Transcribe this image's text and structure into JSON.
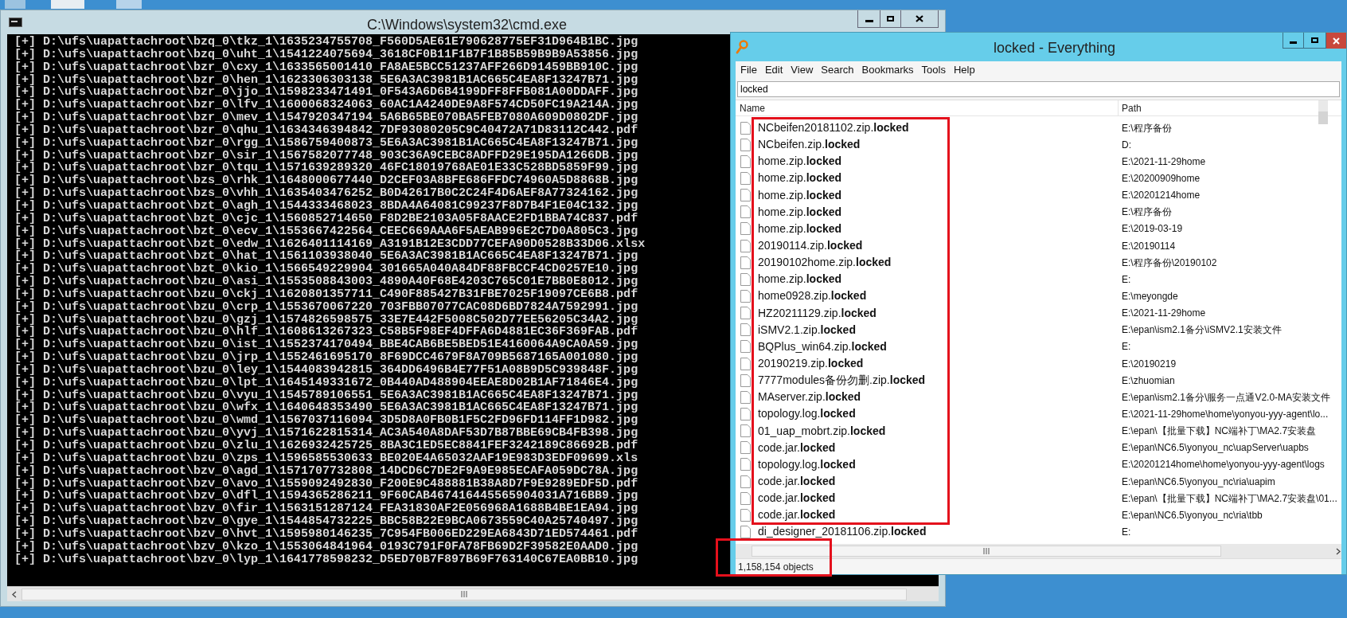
{
  "cmd_window": {
    "title": "C:\\Windows\\system32\\cmd.exe",
    "lines": [
      "[+] D:\\ufs\\uapattachroot\\bzq_0\\tkz_1\\1635234755708_F560D5AE61E790628775EF31D964B1BC.jpg",
      "[+] D:\\ufs\\uapattachroot\\bzq_0\\uht_1\\1541224075694_3618CF0B11F1B7F1B85B59B9B9A53856.jpg",
      "[+] D:\\ufs\\uapattachroot\\bzr_0\\cxy_1\\1633565001410_FA8AE5BCC51237AFF266D91459BB910C.jpg",
      "[+] D:\\ufs\\uapattachroot\\bzr_0\\hen_1\\1623306303138_5E6A3AC3981B1AC665C4EA8F13247B71.jpg",
      "[+] D:\\ufs\\uapattachroot\\bzr_0\\jjo_1\\1598233471491_0F543A6D6B4199DFF8FFB081A00DDAFF.jpg",
      "[+] D:\\ufs\\uapattachroot\\bzr_0\\lfv_1\\1600068324063_60AC1A4240DE9A8F574CD50FC19A214A.jpg",
      "[+] D:\\ufs\\uapattachroot\\bzr_0\\mev_1\\1547920347194_5A6B65BE070BA5FEB7080A609D0802DF.jpg",
      "[+] D:\\ufs\\uapattachroot\\bzr_0\\qhu_1\\1634346394842_7DF93080205C9C40472A71D83112C442.pdf",
      "[+] D:\\ufs\\uapattachroot\\bzr_0\\rgg_1\\1586759400873_5E6A3AC3981B1AC665C4EA8F13247B71.jpg",
      "[+] D:\\ufs\\uapattachroot\\bzr_0\\sir_1\\1567582077748_903C36A9CEBC8ADFFD29E195DA1266DB.jpg",
      "[+] D:\\ufs\\uapattachroot\\bzr_0\\tqu_1\\1571639289320_46FC18019768AE01E33C528BD5859F99.jpg",
      "[+] D:\\ufs\\uapattachroot\\bzs_0\\rhk_1\\1648000677440_D2CEF03A8BFE686FFDC74960A5D8868B.jpg",
      "[+] D:\\ufs\\uapattachroot\\bzs_0\\vhh_1\\1635403476252_B0D42617B0C2C24F4D6AEF8A77324162.jpg",
      "[+] D:\\ufs\\uapattachroot\\bzt_0\\agh_1\\1544333468023_8BDA4A64081C99237F8D7B4F1E04C132.jpg",
      "[+] D:\\ufs\\uapattachroot\\bzt_0\\cjc_1\\1560852714650_F8D2BE2103A05F8AACE2FD1BBA74C837.pdf",
      "[+] D:\\ufs\\uapattachroot\\bzt_0\\ecv_1\\1553667422564_CEEC669AAA6F5AEAB996E2C7D0A805C3.jpg",
      "[+] D:\\ufs\\uapattachroot\\bzt_0\\edw_1\\1626401114169_A3191B12E3CDD77CEFA90D0528B33D06.xlsx",
      "[+] D:\\ufs\\uapattachroot\\bzt_0\\hat_1\\1561103938040_5E6A3AC3981B1AC665C4EA8F13247B71.jpg",
      "[+] D:\\ufs\\uapattachroot\\bzt_0\\kio_1\\1566549229904_301665A040A84DF88FBCCF4CD0257E10.jpg",
      "[+] D:\\ufs\\uapattachroot\\bzu_0\\asi_1\\1553508843003_4890A40F68E4203C765C01E7BB0E8012.jpg",
      "[+] D:\\ufs\\uapattachroot\\bzu_0\\ckj_1\\1620801357711_C490F885427B31FBE7025F19097CE6B8.pdf",
      "[+] D:\\ufs\\uapattachroot\\bzu_0\\crp_1\\1553670067220_703FBB07077CAC08D6BD7824A7592991.jpg",
      "[+] D:\\ufs\\uapattachroot\\bzu_0\\gzj_1\\1574826598575_33E7E442F5008C502D77EE56205C34A2.jpg",
      "[+] D:\\ufs\\uapattachroot\\bzu_0\\hlf_1\\1608613267323_C58B5F98EF4DFFA6D4881EC36F369FAB.pdf",
      "[+] D:\\ufs\\uapattachroot\\bzu_0\\ist_1\\1552374170494_BBE4CAB6BE5BED51E4160064A9CA0A59.jpg",
      "[+] D:\\ufs\\uapattachroot\\bzu_0\\jrp_1\\1552461695170_8F69DCC4679F8A709B5687165A001080.jpg",
      "[+] D:\\ufs\\uapattachroot\\bzu_0\\ley_1\\1544083942815_364DD6496B4E77F51A08B9D5C939848F.jpg",
      "[+] D:\\ufs\\uapattachroot\\bzu_0\\lpt_1\\1645149331672_0B440AD488904EEAE8D02B1AF71846E4.jpg",
      "[+] D:\\ufs\\uapattachroot\\bzu_0\\vyu_1\\1545789106551_5E6A3AC3981B1AC665C4EA8F13247B71.jpg",
      "[+] D:\\ufs\\uapattachroot\\bzu_0\\wfx_1\\1640648353490_5E6A3AC3981B1AC665C4EA8F13247B71.jpg",
      "[+] D:\\ufs\\uapattachroot\\bzu_0\\wmd_1\\1567037116094_3D5D8A0FB0B1F5C2FD96FD114FF1D982.jpg",
      "[+] D:\\ufs\\uapattachroot\\bzu_0\\yvj_1\\1571622815314_AC3A540A8DAF53D7B87BBE69CB4FB398.jpg",
      "[+] D:\\ufs\\uapattachroot\\bzu_0\\zlu_1\\1626932425725_8BA3C1ED5EC8841FEF3242189C86692B.pdf",
      "[+] D:\\ufs\\uapattachroot\\bzu_0\\zps_1\\1596585530633_BE020E4A65032AAF19E983D3EDF09699.xls",
      "[+] D:\\ufs\\uapattachroot\\bzv_0\\agd_1\\1571707732808_14DCD6C7DE2F9A9E985ECAFA059DC78A.jpg",
      "[+] D:\\ufs\\uapattachroot\\bzv_0\\avo_1\\1559092492830_F200E9C488881B38A8D7F9E9289EDF5D.pdf",
      "[+] D:\\ufs\\uapattachroot\\bzv_0\\dfl_1\\1594365286211_9F60CAB467416445565904031A716BB9.jpg",
      "[+] D:\\ufs\\uapattachroot\\bzv_0\\fir_1\\1563151287124_FEA31830AF2E056968A1688B4BE1EA94.jpg",
      "[+] D:\\ufs\\uapattachroot\\bzv_0\\gye_1\\1544854732225_BBC58B22E9BCA0673559C40A25740497.jpg",
      "[+] D:\\ufs\\uapattachroot\\bzv_0\\hvt_1\\1595980146235_7C954FB006ED229EA6843D71ED574461.pdf",
      "[+] D:\\ufs\\uapattachroot\\bzv_0\\kzo_1\\1553064841964_0193C791F0FA78FB69D2F39582E0AAD0.jpg",
      "[+] D:\\ufs\\uapattachroot\\bzv_0\\lyp_1\\1641778598232_D5ED70B7F897B69F763140C67EA0BB10.jpg"
    ]
  },
  "everything_window": {
    "title": "locked - Everything",
    "menu": [
      "File",
      "Edit",
      "View",
      "Search",
      "Bookmarks",
      "Tools",
      "Help"
    ],
    "search": {
      "value": "locked"
    },
    "columns": [
      "Name",
      "Path"
    ],
    "rows": [
      {
        "name": "NCbeifen20181102.zip.**locked**",
        "path": "E:\\程序备份"
      },
      {
        "name": "NCbeifen.zip.**locked**",
        "path": "D:"
      },
      {
        "name": "home.zip.**locked**",
        "path": "E:\\2021-11-29home"
      },
      {
        "name": "home.zip.**locked**",
        "path": "E:\\20200909home"
      },
      {
        "name": "home.zip.**locked**",
        "path": "E:\\20201214home"
      },
      {
        "name": "home.zip.**locked**",
        "path": "E:\\程序备份"
      },
      {
        "name": "home.zip.**locked**",
        "path": "E:\\2019-03-19"
      },
      {
        "name": "20190114.zip.**locked**",
        "path": "E:\\20190114"
      },
      {
        "name": "20190102home.zip.**locked**",
        "path": "E:\\程序备份\\20190102"
      },
      {
        "name": "home.zip.**locked**",
        "path": "E:"
      },
      {
        "name": "home0928.zip.**locked**",
        "path": "E:\\meyongde"
      },
      {
        "name": "HZ20211129.zip.**locked**",
        "path": "E:\\2021-11-29home"
      },
      {
        "name": "iSMV2.1.zip.**locked**",
        "path": "E:\\epan\\ism2.1备分\\iSMV2.1安装文件"
      },
      {
        "name": "BQPlus_win64.zip.**locked**",
        "path": "E:"
      },
      {
        "name": "20190219.zip.**locked**",
        "path": "E:\\20190219"
      },
      {
        "name": "7777modules备份勿删.zip.**locked**",
        "path": "E:\\zhuomian"
      },
      {
        "name": "MAserver.zip.**locked**",
        "path": "E:\\epan\\ism2.1备分\\服务一点通V2.0-MA安装文件"
      },
      {
        "name": "topology.log.**locked**",
        "path": "E:\\2021-11-29home\\home\\yonyou-yyy-agent\\lo..."
      },
      {
        "name": "01_uap_mobrt.zip.**locked**",
        "path": "E:\\epan\\【批量下载】NC端补丁\\MA2.7安装盘"
      },
      {
        "name": "code.jar.**locked**",
        "path": "E:\\epan\\NC6.5\\yonyou_nc\\uapServer\\uapbs"
      },
      {
        "name": "topology.log.**locked**",
        "path": "E:\\20201214home\\home\\yonyou-yyy-agent\\logs"
      },
      {
        "name": "code.jar.**locked**",
        "path": "E:\\epan\\NC6.5\\yonyou_nc\\ria\\uapim"
      },
      {
        "name": "code.jar.**locked**",
        "path": "E:\\epan\\【批量下载】NC端补丁\\MA2.7安装盘\\01..."
      },
      {
        "name": "code.jar.**locked**",
        "path": "E:\\epan\\NC6.5\\yonyou_nc\\ria\\tbb"
      },
      {
        "name": "di_designer_20181106.zip.**locked**",
        "path": "E:"
      }
    ],
    "status_bar": "1,158,154 objects"
  }
}
